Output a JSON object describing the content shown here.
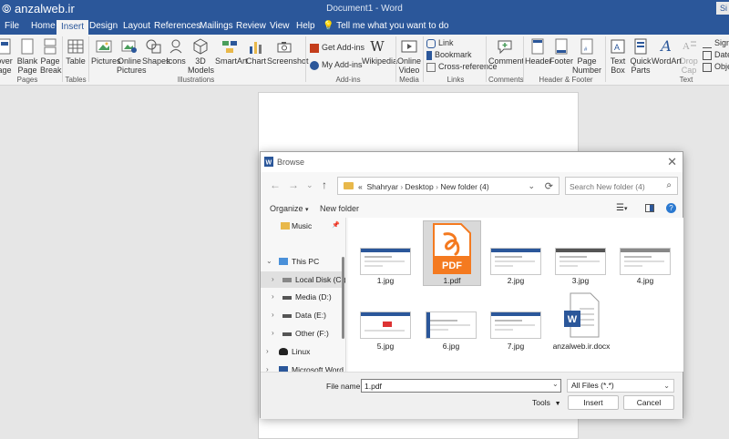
{
  "titlebar": {
    "logo": "anzalweb.ir",
    "doc_title": "Document1 - Word",
    "signin": "Si"
  },
  "tabs": [
    "File",
    "Home",
    "Insert",
    "Design",
    "Layout",
    "References",
    "Mailings",
    "Review",
    "View",
    "Help"
  ],
  "tellme": "Tell me what you want to do",
  "ribbon": {
    "pages": {
      "cover": "over\nage",
      "blank": "Blank\nPage",
      "break": "Page\nBreak",
      "label": "Pages"
    },
    "tables": {
      "table": "Table",
      "label": "Tables"
    },
    "illustrations": {
      "pictures": "Pictures",
      "online_pictures": "Online\nPictures",
      "shapes": "Shapes",
      "icons": "Icons",
      "models": "3D\nModels",
      "smartart": "SmartArt",
      "chart": "Chart",
      "screenshot": "Screenshot",
      "label": "Illustrations"
    },
    "addins": {
      "get": "Get Add-ins",
      "my": "My Add-ins",
      "wikipedia": "Wikipedia",
      "label": "Add-ins"
    },
    "media": {
      "online_video": "Online\nVideo",
      "label": "Media"
    },
    "links": {
      "link": "Link",
      "bookmark": "Bookmark",
      "cross": "Cross-reference",
      "label": "Links"
    },
    "comments": {
      "comment": "Comment",
      "label": "Comments"
    },
    "header_footer": {
      "header": "Header",
      "footer": "Footer",
      "page_number": "Page\nNumber",
      "label": "Header & Footer"
    },
    "text": {
      "textbox": "Text\nBox",
      "quickparts": "Quick\nParts",
      "wordart": "WordArt",
      "dropcap": "Drop\nCap",
      "signature": "Signa",
      "date": "Date",
      "object": "Objec",
      "label": "Text"
    }
  },
  "dialog": {
    "title": "Browse",
    "address": {
      "prefix": "«",
      "crumbs": [
        "Shahryar",
        "Desktop",
        "New folder (4)"
      ]
    },
    "search_placeholder": "Search New folder (4)",
    "organize": "Organize",
    "new_folder": "New folder",
    "nav": [
      {
        "label": "Music"
      },
      {
        "label": "This PC"
      },
      {
        "label": "Local Disk (C:)"
      },
      {
        "label": "Media (D:)"
      },
      {
        "label": "Data (E:)"
      },
      {
        "label": "Other (F:)"
      },
      {
        "label": "Linux"
      },
      {
        "label": "Microsoft Word"
      }
    ],
    "files": [
      {
        "name": "1.jpg",
        "kind": "jpg"
      },
      {
        "name": "1.pdf",
        "kind": "pdf",
        "selected": true
      },
      {
        "name": "2.jpg",
        "kind": "jpg"
      },
      {
        "name": "3.jpg",
        "kind": "jpg"
      },
      {
        "name": "4.jpg",
        "kind": "jpg"
      },
      {
        "name": "5.jpg",
        "kind": "jpg"
      },
      {
        "name": "6.jpg",
        "kind": "jpg"
      },
      {
        "name": "7.jpg",
        "kind": "jpg"
      },
      {
        "name": "anzalweb.ir.docx",
        "kind": "docx"
      }
    ],
    "pdf_badge": "PDF",
    "filename_label": "File name:",
    "filename_value": "1.pdf",
    "filter": "All Files (*.*)",
    "tools": "Tools",
    "insert": "Insert",
    "cancel": "Cancel"
  },
  "colors": {
    "word_blue": "#2b579a",
    "pdf_orange": "#f47a20",
    "selection": "#d9d9d9"
  }
}
